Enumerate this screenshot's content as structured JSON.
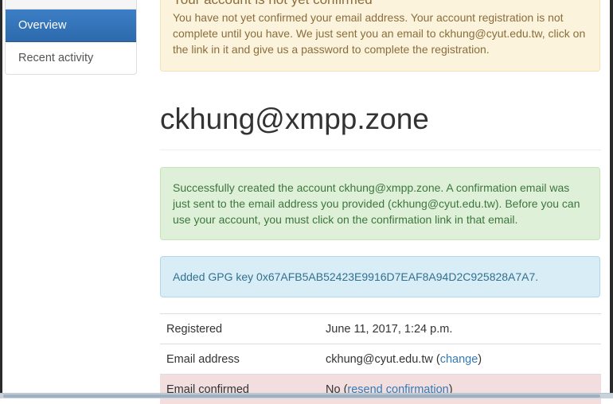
{
  "sidebar": {
    "items": [
      {
        "label": "Overview",
        "active": true
      },
      {
        "label": "Recent activity",
        "active": false
      }
    ]
  },
  "warning": {
    "title": "Your account is not yet confirmed",
    "body": "You have not yet confirmed your email address. Your account registration is not complete until you have. We just sent you an email to ckhung@cyut.edu.tw, click on the link in it and give us a password to complete the registration."
  },
  "page_title": "ckhung@xmpp.zone",
  "success": {
    "message": "Successfully created the account ckhung@xmpp.zone. A confirmation email was just sent to the email address you provided (ckhung@cyut.edu.tw). Before you can use your account, you must click on the confirmation link in that email."
  },
  "info": {
    "message": "Added GPG key 0x67AFB5AB52423E9916D7EAF8A94D2C925828A7A7."
  },
  "details": {
    "registered_label": "Registered",
    "registered_value": "June 11, 2017, 1:24 p.m.",
    "email_label": "Email address",
    "email_value": "ckhung@cyut.edu.tw",
    "email_open": " (",
    "email_change_link": "change",
    "email_close": ")",
    "confirmed_label": "Email confirmed",
    "confirmed_value": "No",
    "confirmed_open": " (",
    "confirmed_link": "resend confirmation",
    "confirmed_close": ")"
  },
  "colors": {
    "primary": "#337ab7",
    "warning_bg": "#fcf3dc",
    "success_bg": "#dff0d8",
    "info_bg": "#d9edf7",
    "danger_bg": "#f2dede"
  }
}
